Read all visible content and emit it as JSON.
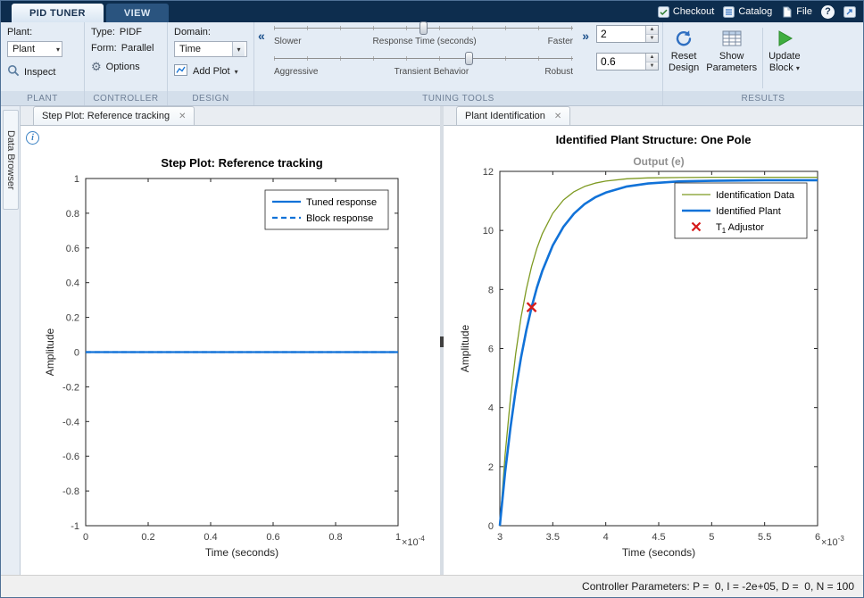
{
  "icons": {
    "caret_down": "▾",
    "chevrons_left": "«",
    "chevrons_right": "»",
    "gear": "⚙",
    "spinner_up": "▲",
    "spinner_down": "▼",
    "info": "i",
    "close": "✕",
    "help": "?"
  },
  "titlebar": {
    "tabs": [
      {
        "label": "PID TUNER"
      },
      {
        "label": "VIEW"
      }
    ],
    "quick_access": [
      {
        "label": "Checkout"
      },
      {
        "label": "Catalog"
      },
      {
        "label": "File"
      }
    ]
  },
  "toolstrip": {
    "plant": {
      "section_label": "PLANT",
      "field_label": "Plant:",
      "dropdown_value": "Plant",
      "inspect_label": "Inspect"
    },
    "controller": {
      "section_label": "CONTROLLER",
      "type_label": "Type:",
      "type_value": "PIDF",
      "form_label": "Form:",
      "form_value": "Parallel",
      "options_label": "Options"
    },
    "design": {
      "section_label": "DESIGN",
      "domain_label": "Domain:",
      "domain_value": "Time",
      "add_plot_label": "Add Plot"
    },
    "tuning_tools": {
      "section_label": "TUNING TOOLS",
      "response_slider": {
        "left": "Slower",
        "center": "Response Time (seconds)",
        "right": "Faster",
        "pos": 0.5
      },
      "transient_slider": {
        "left": "Aggressive",
        "center": "Transient Behavior",
        "right": "Robust",
        "pos": 0.655
      },
      "response_value": "2",
      "transient_value": "0.6"
    },
    "results": {
      "section_label": "RESULTS",
      "reset_line1": "Reset",
      "reset_line2": "Design",
      "show_line1": "Show",
      "show_line2": "Parameters",
      "update_line1": "Update",
      "update_line2": "Block"
    }
  },
  "data_browser": {
    "label": "Data Browser"
  },
  "left_panel": {
    "tab_label": "Step Plot: Reference tracking"
  },
  "right_panel": {
    "tab_label": "Plant Identification",
    "heading": "Identified Plant Structure: One Pole"
  },
  "status_bar": {
    "text": "Controller Parameters: P =  0, I = -2e+05, D =  0, N = 100"
  },
  "chart_data": [
    {
      "type": "line",
      "title": "Step Plot: Reference tracking",
      "xlabel": "Time (seconds)",
      "ylabel": "Amplitude",
      "x_exponent": "-4",
      "xlim": [
        0,
        1
      ],
      "ylim": [
        -1,
        1
      ],
      "xticks": [
        0,
        0.2,
        0.4,
        0.6,
        0.8,
        1
      ],
      "yticks": [
        -1,
        -0.8,
        -0.6,
        -0.4,
        -0.2,
        0,
        0.2,
        0.4,
        0.6,
        0.8,
        1
      ],
      "grid": false,
      "legend_position": "top-right",
      "series": [
        {
          "name": "Block response",
          "color": "#1172D8",
          "width": 2.2,
          "dash": "6 4",
          "points": [
            [
              0,
              0
            ],
            [
              1,
              0
            ]
          ]
        },
        {
          "name": "Tuned response",
          "color": "#1172D8",
          "width": 2.2,
          "dash": null,
          "points": [
            [
              0,
              0
            ],
            [
              1,
              0
            ]
          ]
        }
      ],
      "legend": {
        "entries": [
          {
            "label": "Tuned response",
            "swatch": "solid",
            "color": "#1172D8",
            "w": 2.2
          },
          {
            "label": "Block response",
            "swatch": "dashed",
            "color": "#1172D8",
            "w": 2.2
          }
        ]
      }
    },
    {
      "type": "line",
      "title": "Output (e)",
      "xlabel": "Time (seconds)",
      "ylabel": "Amplitude",
      "x_exponent": "-3",
      "xlim": [
        3,
        6
      ],
      "ylim": [
        0,
        12
      ],
      "xticks": [
        3,
        3.5,
        4,
        4.5,
        5,
        5.5,
        6
      ],
      "yticks": [
        0,
        2,
        4,
        6,
        8,
        10,
        12
      ],
      "grid": false,
      "legend_position": "top-right",
      "series": [
        {
          "name": "Identification Data",
          "color": "#7E9A22",
          "width": 1.3,
          "dash": null,
          "points": [
            [
              3,
              0
            ],
            [
              3.05,
              2.4
            ],
            [
              3.1,
              4.31
            ],
            [
              3.15,
              5.83
            ],
            [
              3.2,
              7.05
            ],
            [
              3.25,
              8.01
            ],
            [
              3.3,
              8.78
            ],
            [
              3.35,
              9.39
            ],
            [
              3.4,
              9.88
            ],
            [
              3.5,
              10.58
            ],
            [
              3.6,
              11.03
            ],
            [
              3.7,
              11.31
            ],
            [
              3.8,
              11.49
            ],
            [
              3.9,
              11.6
            ],
            [
              4,
              11.67
            ],
            [
              4.2,
              11.75
            ],
            [
              4.4,
              11.78
            ],
            [
              4.7,
              11.79
            ],
            [
              5,
              11.8
            ],
            [
              5.5,
              11.8
            ],
            [
              6,
              11.8
            ]
          ]
        },
        {
          "name": "Identified Plant",
          "color": "#1172D8",
          "width": 2.6,
          "dash": null,
          "points": [
            [
              3,
              0
            ],
            [
              3.05,
              1.8
            ],
            [
              3.1,
              3.32
            ],
            [
              3.15,
              4.6
            ],
            [
              3.2,
              5.69
            ],
            [
              3.25,
              6.62
            ],
            [
              3.3,
              7.4
            ],
            [
              3.35,
              8.06
            ],
            [
              3.4,
              8.62
            ],
            [
              3.5,
              9.49
            ],
            [
              3.6,
              10.12
            ],
            [
              3.7,
              10.57
            ],
            [
              3.8,
              10.89
            ],
            [
              3.9,
              11.12
            ],
            [
              4,
              11.28
            ],
            [
              4.2,
              11.49
            ],
            [
              4.4,
              11.59
            ],
            [
              4.7,
              11.66
            ],
            [
              5,
              11.68
            ],
            [
              5.5,
              11.7
            ],
            [
              6,
              11.7
            ]
          ]
        }
      ],
      "markers": [
        {
          "x": 3.3,
          "y": 7.4,
          "shape": "x",
          "color": "#D61A1A",
          "name": "T1 Adjustor"
        }
      ],
      "legend": {
        "entries": [
          {
            "label": "Identification Data",
            "swatch": "solid",
            "color": "#7E9A22",
            "w": 1.3
          },
          {
            "label": "Identified Plant",
            "swatch": "solid",
            "color": "#1172D8",
            "w": 2.6
          },
          {
            "label": "T",
            "sub": "1",
            "rest": " Adjustor",
            "swatch": "x",
            "color": "#D61A1A"
          }
        ]
      }
    }
  ]
}
